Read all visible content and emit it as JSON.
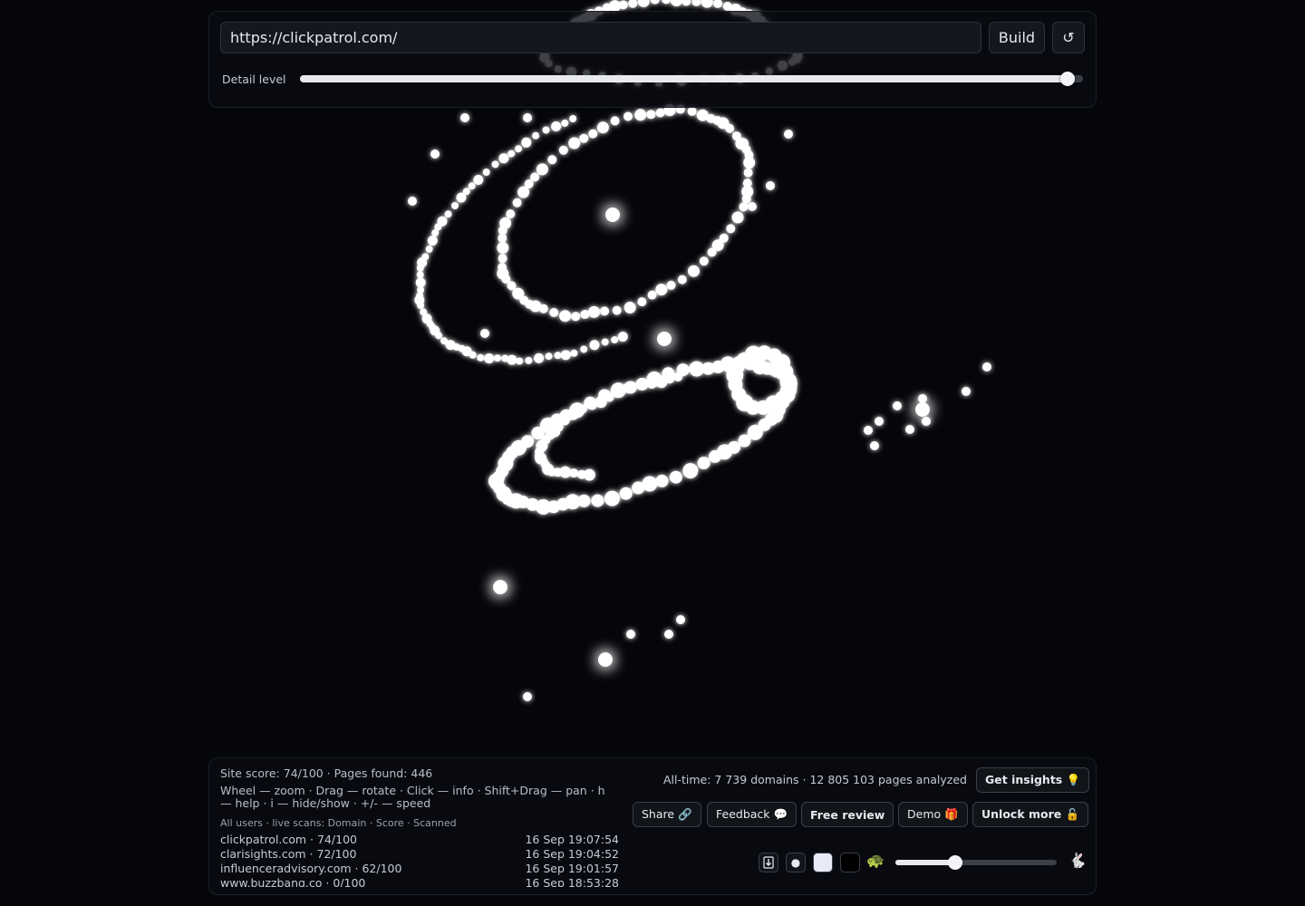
{
  "top": {
    "url_value": "https://clickpatrol.com/",
    "build_label": "Build",
    "reset_label": "↺",
    "detail_label": "Detail level",
    "detail_level": 0.98
  },
  "stats": {
    "site_score": "Site score: 74/100 · Pages found: 446",
    "help": "Wheel — zoom · Drag — rotate · Click — info · Shift+Drag — pan · h — help · i — hide/show · +/- — speed",
    "scans_header": "All users · live scans: Domain · Score · Scanned",
    "scans": [
      {
        "domain": "clickpatrol.com · 74/100",
        "time": "16 Sep 19:07:54"
      },
      {
        "domain": "clarisights.com · 72/100",
        "time": "16 Sep 19:04:52"
      },
      {
        "domain": "influenceradvisory.com · 62/100",
        "time": "16 Sep 19:01:57"
      },
      {
        "domain": "www.buzzbang.co · 0/100",
        "time": "16 Sep 18:53:28"
      }
    ],
    "alltime": "All-time: 7 739 domains · 12 805 103 pages analyzed"
  },
  "actions": {
    "insights": "Get insights 💡",
    "share": "Share 🔗",
    "feedback": "Feedback 💬",
    "free_review": "Free review",
    "demo": "Demo 🎁",
    "unlock": "Unlock more 🔓"
  },
  "controls": {
    "download_icon": "download-icon",
    "dot_icon": "●",
    "light_swatch": "#e8ebf5",
    "dark_swatch": "#000000",
    "slow_icon": "🐢",
    "fast_icon": "🐇",
    "speed_level": 0.37
  }
}
